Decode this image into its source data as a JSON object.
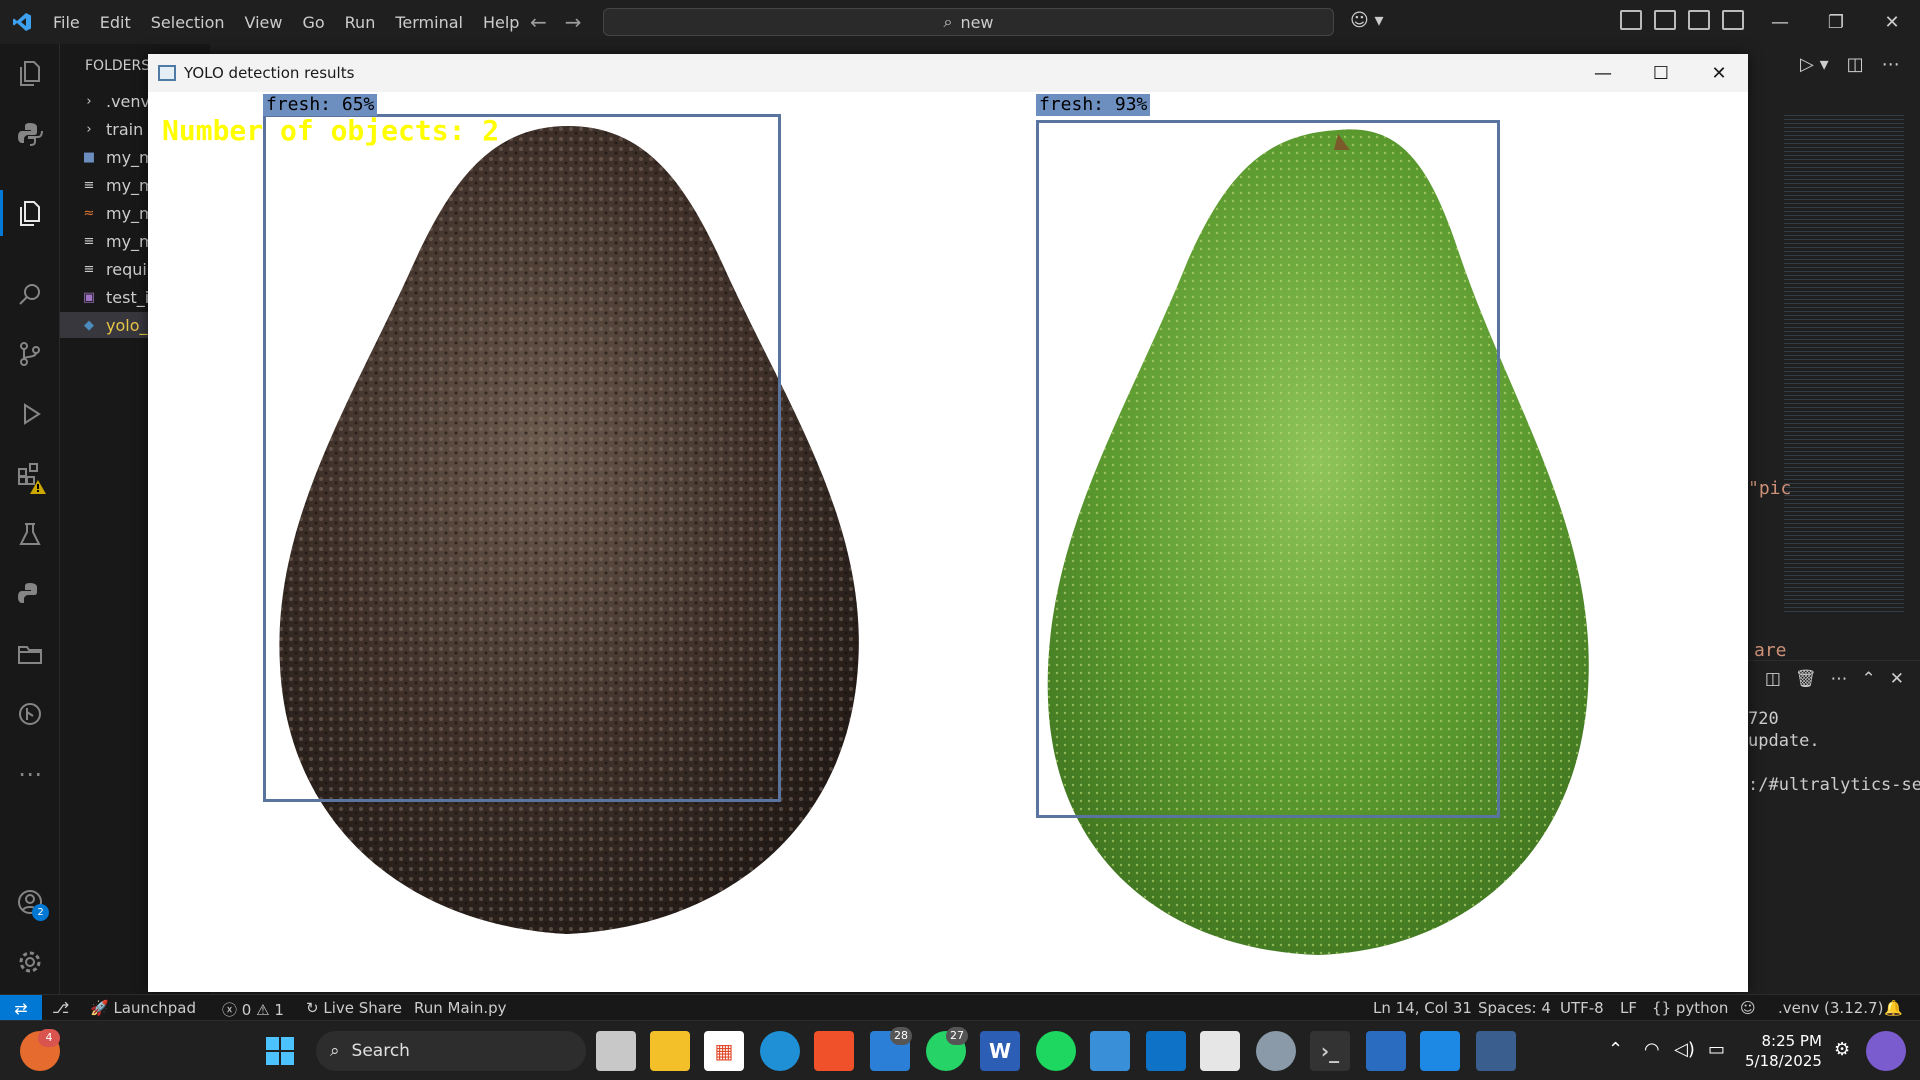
{
  "titlebar": {
    "menu": [
      "File",
      "Edit",
      "Selection",
      "View",
      "Go",
      "Run",
      "Terminal",
      "Help"
    ],
    "search_text": "new"
  },
  "explorer": {
    "title": "FOLDERS:",
    "items": [
      {
        "label": ".venv",
        "icon": "chevron-right-icon"
      },
      {
        "label": "train",
        "icon": "chevron-right-icon"
      },
      {
        "label": "my_mo",
        "icon": "file-icon"
      },
      {
        "label": "my_mo",
        "icon": "text-file-icon"
      },
      {
        "label": "my_mo",
        "icon": "rss-file-icon"
      },
      {
        "label": "my_mo",
        "icon": "text-file-icon"
      },
      {
        "label": "require",
        "icon": "text-file-icon"
      },
      {
        "label": "test_im",
        "icon": "image-file-icon"
      },
      {
        "label": "yolo_d",
        "icon": "python-file-icon"
      }
    ]
  },
  "activity": {
    "accounts_badge": "2"
  },
  "editor": {
    "snippet_1": "\"pic",
    "snippet_2": "are"
  },
  "terminal": {
    "lines": [
      "720",
      "update.",
      "",
      ":/#ultralytics-se"
    ]
  },
  "yolo_window": {
    "title": "YOLO detection results",
    "count_text": "Number of objects: 2",
    "detections": [
      {
        "label": "fresh: 65%",
        "color": "#4a3a30"
      },
      {
        "label": "fresh: 93%",
        "color": "#6fa83a"
      }
    ]
  },
  "statusbar": {
    "problems_errors": "0",
    "problems_warnings": "1",
    "launchpad": "Launchpad",
    "live_share": "Live Share",
    "run": "Run Main.py",
    "position": "Ln 14, Col 31",
    "spaces": "Spaces: 4",
    "encoding": "UTF-8",
    "eol": "LF",
    "language": "python",
    "interpreter": ".venv (3.12.7)"
  },
  "taskbar": {
    "search_placeholder": "Search",
    "notif_badge": "4",
    "badge_1": "28",
    "badge_2": "27",
    "time": "8:25 PM",
    "date": "5/18/2025"
  },
  "colors": {
    "accent": "#0078d4",
    "box_color": "#5a74a0",
    "label_bg": "#6d8fc0",
    "count_text": "#ffff00"
  }
}
